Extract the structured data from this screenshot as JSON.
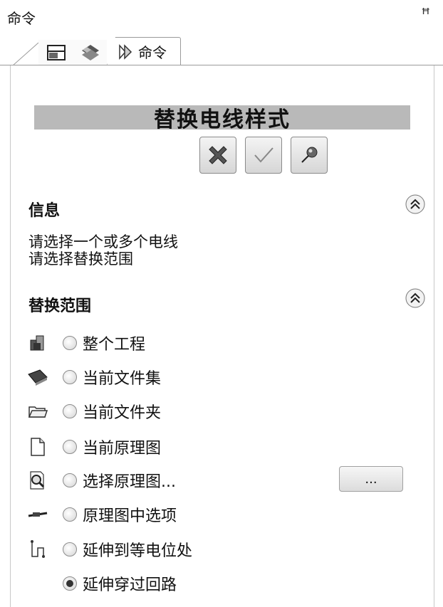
{
  "window": {
    "title": "命令",
    "pin_glyph": "ꟸ"
  },
  "tabs": [
    {
      "name": "model-tab",
      "icon": "model-icon"
    },
    {
      "name": "layers-tab",
      "icon": "layers-icon"
    },
    {
      "name": "commands-tab",
      "icon": "commands-icon",
      "label": "命令"
    }
  ],
  "command": {
    "title": "替换电线样式",
    "buttons": [
      "cancel-icon",
      "ok-check-icon",
      "pushpin-icon"
    ]
  },
  "info": {
    "heading": "信息",
    "lines": [
      "请选择一个或多个电线",
      "请选择替换范围"
    ]
  },
  "scope": {
    "heading": "替换范围",
    "options": [
      {
        "label": "整个工程",
        "icon": "project-icon",
        "checked": false
      },
      {
        "label": "当前文件集",
        "icon": "book-icon",
        "checked": false
      },
      {
        "label": "当前文件夹",
        "icon": "folder-icon",
        "checked": false
      },
      {
        "label": "当前原理图",
        "icon": "document-icon",
        "checked": false
      },
      {
        "label": "选择原理图...",
        "icon": "magnifier-icon",
        "checked": false
      },
      {
        "label": "原理图中选项",
        "icon": "wire-icon",
        "checked": false
      },
      {
        "label": "延伸到等电位处",
        "icon": "connector-icon",
        "checked": false
      },
      {
        "label": "延伸穿过回路",
        "icon": "",
        "checked": true
      }
    ],
    "browse_label": "..."
  }
}
